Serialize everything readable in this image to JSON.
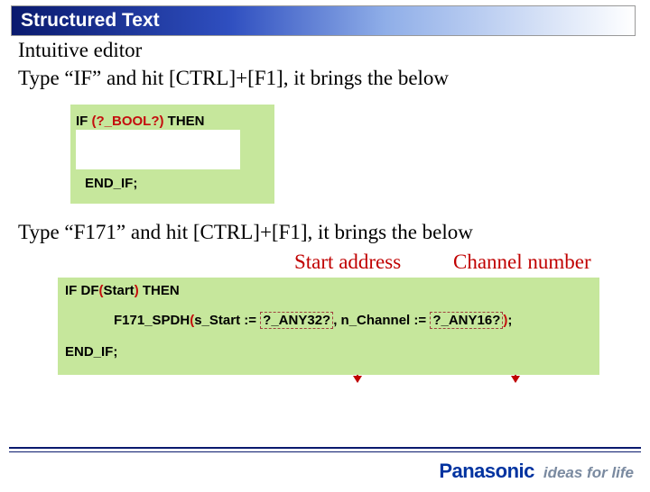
{
  "header": {
    "title": "Structured Text"
  },
  "body": {
    "line1": "Intuitive editor",
    "line2": "Type “IF” and hit [CTRL]+[F1], it brings the below",
    "line3": "Type “F171” and hit [CTRL]+[F1], it brings the below"
  },
  "code1": {
    "kw_if": "IF ",
    "paren_open": "(",
    "placeholder_bool": "?_BOOL?",
    "paren_close": ")",
    "kw_then": " THEN",
    "kw_endif": "END_IF;"
  },
  "annotations": {
    "start_address": "Start address",
    "channel_number": "Channel number"
  },
  "code2": {
    "line1_if": "IF DF",
    "line1_paren_open": "(",
    "line1_arg": "Start",
    "line1_paren_close": ")",
    "line1_then": " THEN",
    "line2_fn": "F171_SPDH",
    "line2_paren_open": "(",
    "line2_p1name": "s_Start := ",
    "line2_p1val": "?_ANY32?",
    "line2_sep": ", ",
    "line2_p2name": "n_Channel := ",
    "line2_p2val": "?_ANY16?",
    "line2_paren_close": ")",
    "line2_semi": ";",
    "line3_endif": "END_IF;"
  },
  "footer": {
    "brand": "Panasonic",
    "tagline": "ideas for life"
  }
}
